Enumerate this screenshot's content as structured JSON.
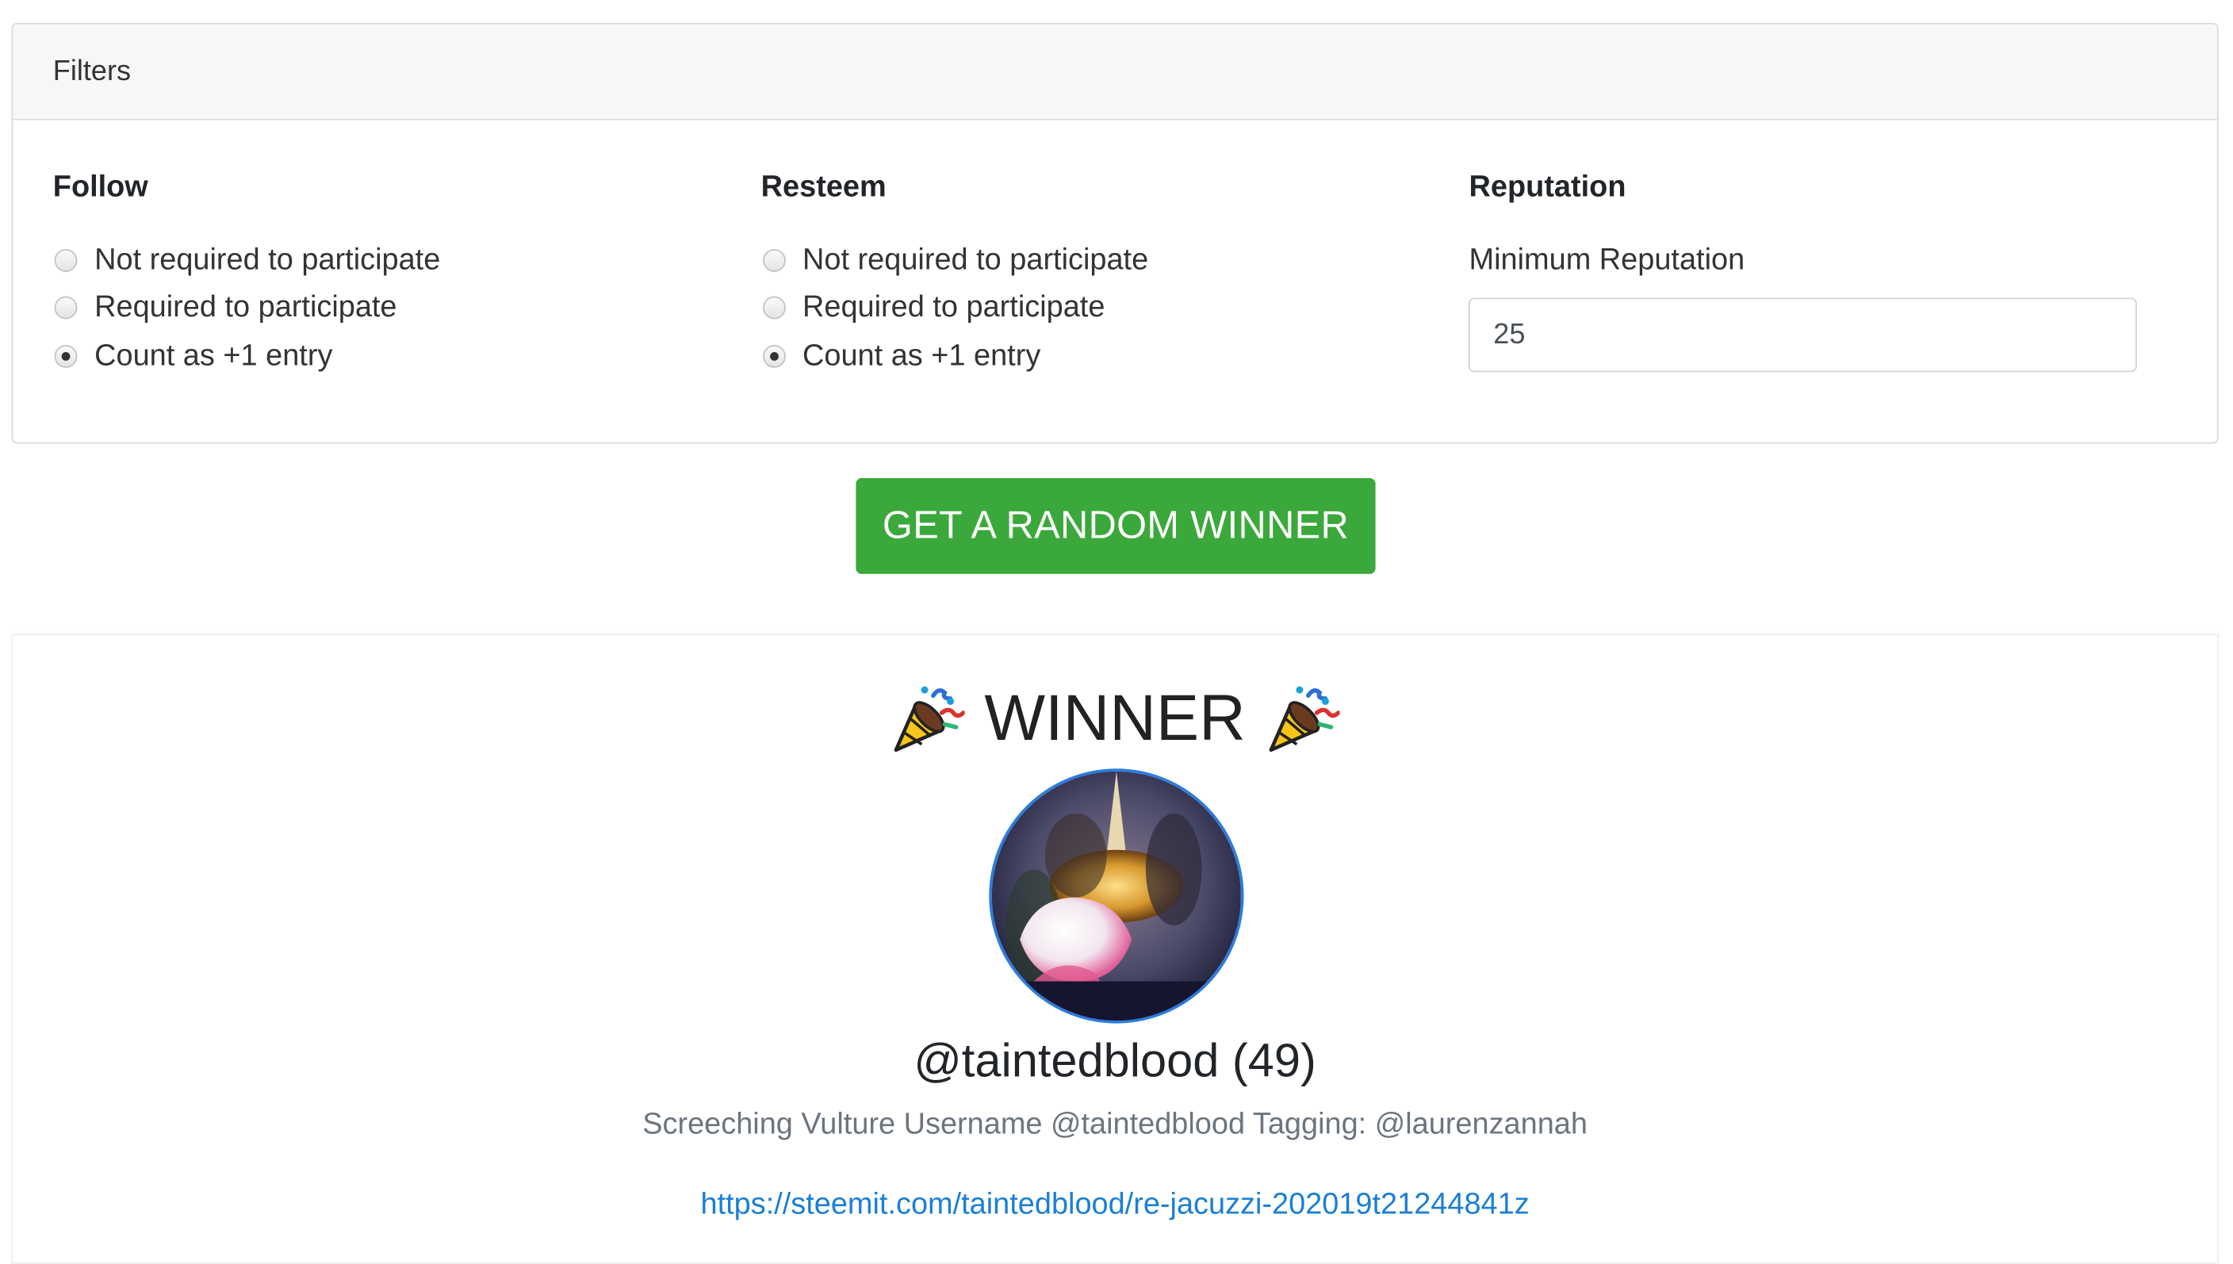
{
  "filters": {
    "header": "Filters",
    "follow": {
      "title": "Follow",
      "options": [
        "Not required to participate",
        "Required to participate",
        "Count as +1 entry"
      ],
      "selected_index": 2
    },
    "resteem": {
      "title": "Resteem",
      "options": [
        "Not required to participate",
        "Required to participate",
        "Count as +1 entry"
      ],
      "selected_index": 2
    },
    "reputation": {
      "title": "Reputation",
      "label": "Minimum Reputation",
      "value": "25"
    }
  },
  "action": {
    "button_label": "GET A RANDOM WINNER",
    "button_color": "#3ba83b"
  },
  "result": {
    "title": "WINNER",
    "title_icon": "party-popper-icon",
    "username": "@taintedblood (49)",
    "comment": "Screeching Vulture Username @taintedblood Tagging: @laurenzannah",
    "link": "https://steemit.com/taintedblood/re-jacuzzi-202019t21244841z",
    "link_color": "#1a7fd6",
    "avatar_border_color": "#2a7de1"
  }
}
